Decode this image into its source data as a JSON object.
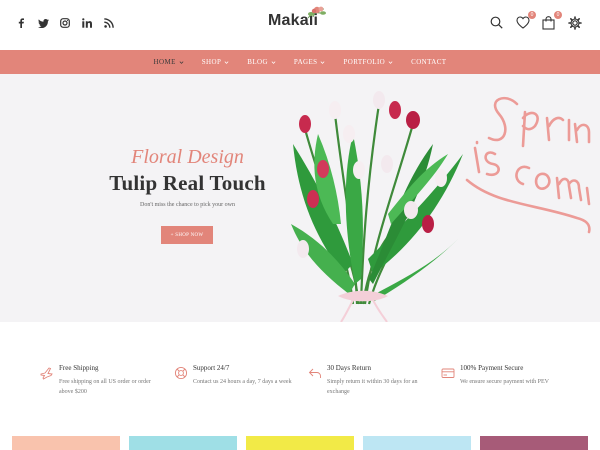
{
  "header": {
    "logo_text": "Makali",
    "social_icons": [
      "facebook-icon",
      "twitter-icon",
      "instagram-icon",
      "linkedin-icon",
      "rss-icon"
    ],
    "wishlist_count": "0",
    "cart_count": "0"
  },
  "nav": {
    "items": [
      {
        "label": "HOME",
        "dropdown": true,
        "active": true
      },
      {
        "label": "SHOP",
        "dropdown": true
      },
      {
        "label": "BLOG",
        "dropdown": true
      },
      {
        "label": "PAGES",
        "dropdown": true
      },
      {
        "label": "PORTFOLIO",
        "dropdown": true
      },
      {
        "label": "CONTACT",
        "dropdown": false
      }
    ]
  },
  "hero": {
    "subtitle": "Floral Design",
    "title": "Tulip Real Touch",
    "note": "Don't miss the chance to pick your own",
    "button": "+ SHOP NOW"
  },
  "features": [
    {
      "icon": "plane-icon",
      "title": "Free Shipping",
      "desc": "Free shipping on all US order or order above $200"
    },
    {
      "icon": "lifebuoy-icon",
      "title": "Support 24/7",
      "desc": "Contact us 24 hours a day, 7 days a week"
    },
    {
      "icon": "return-arrow-icon",
      "title": "30 Days Return",
      "desc": "Simply return it within 30 days for an exchange"
    },
    {
      "icon": "credit-card-icon",
      "title": "100% Payment Secure",
      "desc": "We ensure secure payment with PEV"
    }
  ],
  "colors": {
    "accent": "#e2857a",
    "hero_bg": "#f4f3f5",
    "card_colors": [
      "#f9c3ad",
      "#9fdfe6",
      "#f2ea47",
      "#bde6f3",
      "#a75b78"
    ]
  }
}
